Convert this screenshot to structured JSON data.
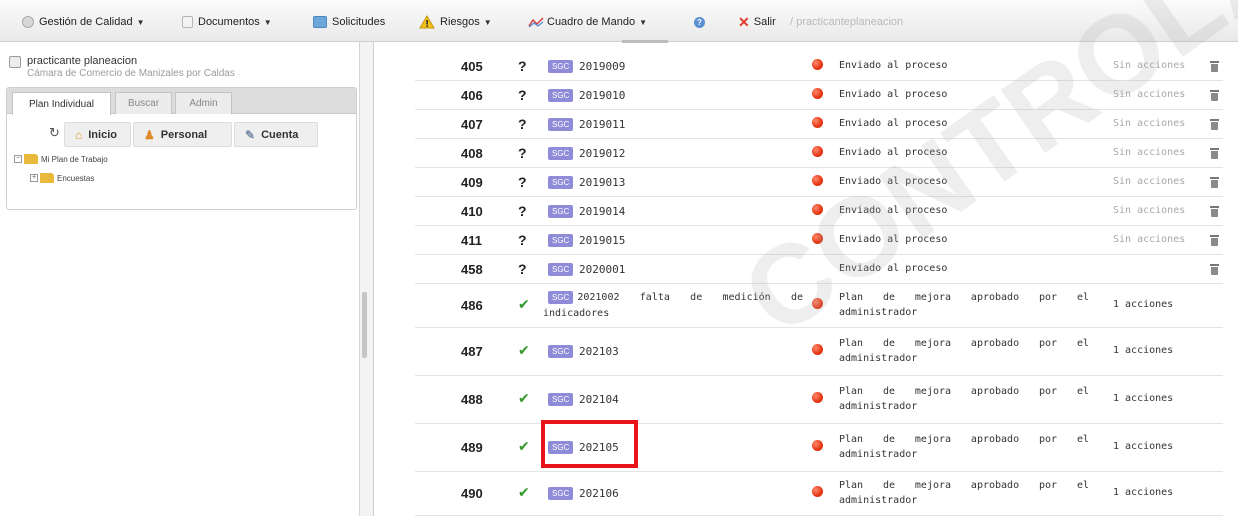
{
  "menu": {
    "gestion": "Gestión de Calidad",
    "documentos": "Documentos",
    "solicitudes": "Solicitudes",
    "riesgos": "Riesgos",
    "cuadro": "Cuadro de Mando",
    "salir": "Salir",
    "salir_user": "/ practicanteplaneacion"
  },
  "user": {
    "name": "practicante planeacion",
    "org": "Cámara de Comercio de Manizales por Caldas"
  },
  "tabs": [
    "Plan Individual",
    "Buscar",
    "Admin"
  ],
  "buttons": {
    "inicio": "Inicio",
    "personal": "Personal",
    "cuenta": "Cuenta"
  },
  "tree": {
    "plan": "Mi Plan de Trabajo",
    "encuestas": "Encuestas"
  },
  "tag": "SGC",
  "rows": [
    {
      "num": "405",
      "status": "?",
      "code": "2019009",
      "state": "Enviado al proceso",
      "actions": "Sin acciones",
      "dot": true,
      "trash": true
    },
    {
      "num": "406",
      "status": "?",
      "code": "2019010",
      "state": "Enviado al proceso",
      "actions": "Sin acciones",
      "dot": true,
      "trash": true
    },
    {
      "num": "407",
      "status": "?",
      "code": "2019011",
      "state": "Enviado al proceso",
      "actions": "Sin acciones",
      "dot": true,
      "trash": true
    },
    {
      "num": "408",
      "status": "?",
      "code": "2019012",
      "state": "Enviado al proceso",
      "actions": "Sin acciones",
      "dot": true,
      "trash": true
    },
    {
      "num": "409",
      "status": "?",
      "code": "2019013",
      "state": "Enviado al proceso",
      "actions": "Sin acciones",
      "dot": true,
      "trash": true
    },
    {
      "num": "410",
      "status": "?",
      "code": "2019014",
      "state": "Enviado al proceso",
      "actions": "Sin acciones",
      "dot": true,
      "trash": true
    },
    {
      "num": "411",
      "status": "?",
      "code": "2019015",
      "state": "Enviado al proceso",
      "actions": "Sin acciones",
      "dot": true,
      "trash": true
    },
    {
      "num": "458",
      "status": "?",
      "code": "2020001",
      "state": "Enviado al proceso",
      "actions": "",
      "dot": false,
      "trash": true
    },
    {
      "num": "486",
      "status": "check",
      "code": "2021002 falta de medición de indicadores",
      "state": "Plan de mejora aprobado por el administrador",
      "actions": "1 acciones",
      "dot": true,
      "trash": false
    },
    {
      "num": "487",
      "status": "check",
      "code": "202103",
      "state": "Plan de mejora aprobado por el administrador",
      "actions": "1 acciones",
      "dot": true,
      "trash": false
    },
    {
      "num": "488",
      "status": "check",
      "code": "202104",
      "state": "Plan de mejora aprobado por el administrador",
      "actions": "1 acciones",
      "dot": true,
      "trash": false
    },
    {
      "num": "489",
      "status": "check",
      "code": "202105",
      "state": "Plan de mejora aprobado por el administrador",
      "actions": "1 acciones",
      "dot": true,
      "trash": false
    },
    {
      "num": "490",
      "status": "check",
      "code": "202106",
      "state": "Plan de mejora aprobado por el administrador",
      "actions": "1 acciones",
      "dot": true,
      "trash": false
    }
  ],
  "watermark": "CONTROLADA",
  "colors": {
    "tag": "#8e8cd8",
    "status_dot": "#e63412",
    "check": "#2f9a2b",
    "highlight": "#e8141a"
  }
}
